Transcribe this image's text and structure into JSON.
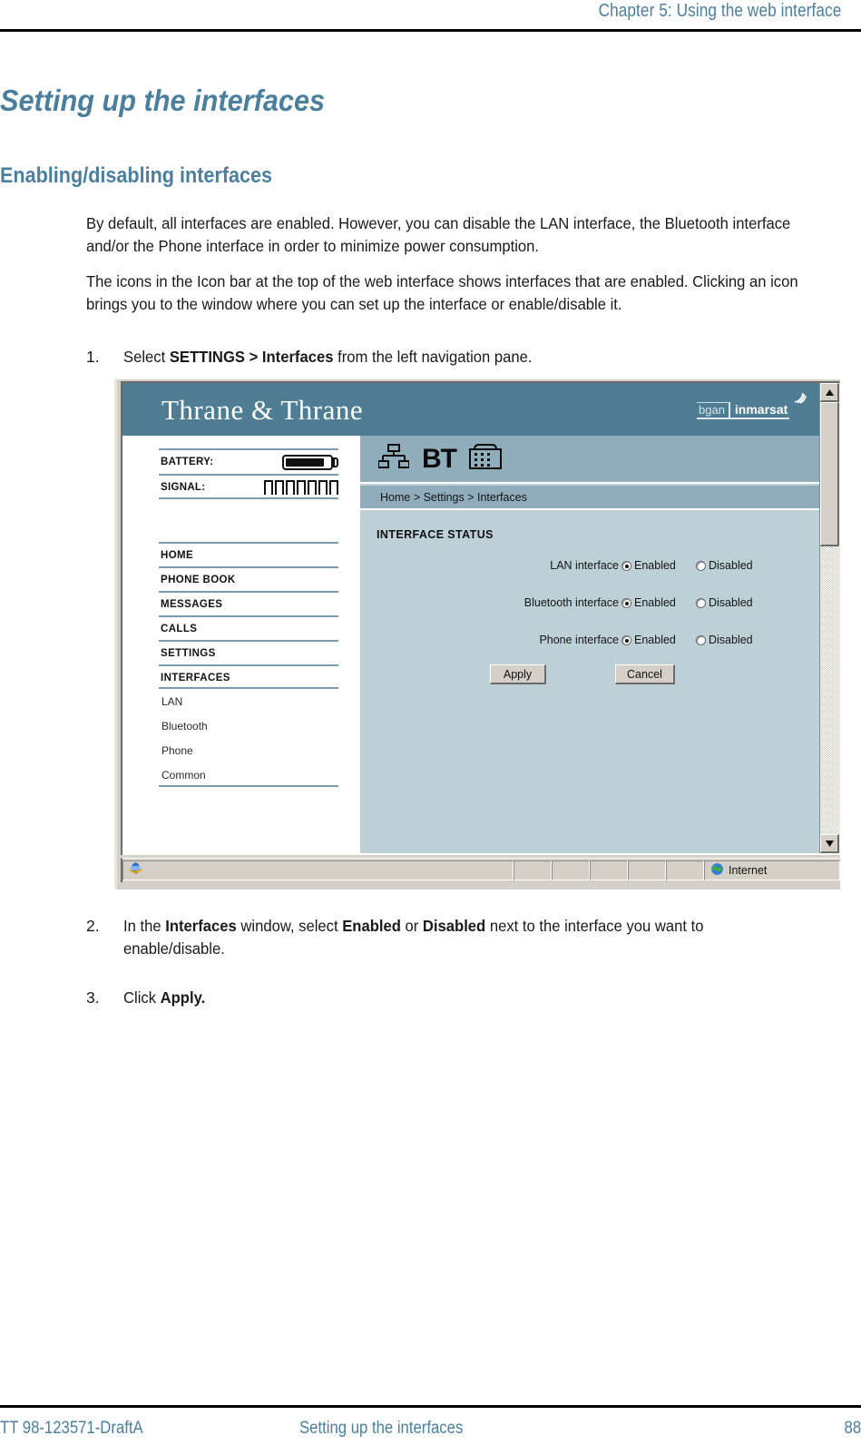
{
  "page": {
    "running_head": "Chapter 5: Using the web interface",
    "h1": "Setting up the interfaces",
    "h2": "Enabling/disabling interfaces",
    "paragraph_1": "By default, all interfaces are enabled. However, you can disable the LAN interface, the Bluetooth interface and/or the Phone interface in order to minimize power consumption.",
    "paragraph_2": "The icons in the Icon bar at the top of the web interface shows interfaces that are enabled. Clicking an icon brings you to the window where you can set up the interface or enable/disable it."
  },
  "steps": [
    {
      "number": "1.",
      "parts": [
        {
          "text": "Select ",
          "bold": false
        },
        {
          "text": "SETTINGS > Interfaces",
          "bold": true
        },
        {
          "text": " from the left navigation pane.",
          "bold": false
        }
      ]
    },
    {
      "number": "2.",
      "parts": [
        {
          "text": "In the ",
          "bold": false
        },
        {
          "text": "Interfaces",
          "bold": true
        },
        {
          "text": " window, select ",
          "bold": false
        },
        {
          "text": "Enabled",
          "bold": true
        },
        {
          "text": " or ",
          "bold": false
        },
        {
          "text": "Disabled",
          "bold": true
        },
        {
          "text": " next to the interface you want to enable/disable.",
          "bold": false
        }
      ]
    },
    {
      "number": "3.",
      "parts": [
        {
          "text": "Click ",
          "bold": false
        },
        {
          "text": "Apply.",
          "bold": true
        }
      ]
    }
  ],
  "screenshot": {
    "brand": {
      "logo_text": "Thrane & Thrane",
      "partner_primary": "bgan",
      "partner_secondary": "inmarsat",
      "satellite_icon": "satellite-signal-arcs-icon",
      "bar_color": "#4e7d94"
    },
    "status": {
      "battery_label": "BATTERY:",
      "battery_icon": "battery-icon",
      "battery_level_percent": 85,
      "signal_label": "SIGNAL:",
      "signal_icon": "signal-bars-icon",
      "signal_bar_count": 7,
      "signal_bars_filled": 0
    },
    "navigation": {
      "main_items": [
        {
          "label": "HOME",
          "name": "home"
        },
        {
          "label": "PHONE BOOK",
          "name": "phone-book"
        },
        {
          "label": "MESSAGES",
          "name": "messages"
        },
        {
          "label": "CALLS",
          "name": "calls"
        },
        {
          "label": "SETTINGS",
          "name": "settings"
        },
        {
          "label": "INTERFACES",
          "name": "interfaces"
        }
      ],
      "sub_items": [
        {
          "label": "LAN",
          "name": "lan"
        },
        {
          "label": "Bluetooth",
          "name": "bluetooth"
        },
        {
          "label": "Phone",
          "name": "phone"
        },
        {
          "label": "Common",
          "name": "common"
        }
      ]
    },
    "icon_bar": {
      "icons": [
        {
          "name": "lan-network-icon",
          "label": "LAN"
        },
        {
          "name": "bluetooth-bt-icon",
          "label": "BT"
        },
        {
          "name": "phone-keypad-icon",
          "label": "Phone"
        }
      ]
    },
    "breadcrumb": "Home > Settings > Interfaces",
    "form": {
      "section_title": "INTERFACE STATUS",
      "rows": [
        {
          "label": "LAN interface",
          "enabled_label": "Enabled",
          "disabled_label": "Disabled",
          "selected": "Enabled"
        },
        {
          "label": "Bluetooth interface",
          "enabled_label": "Enabled",
          "disabled_label": "Disabled",
          "selected": "Enabled"
        },
        {
          "label": "Phone interface",
          "enabled_label": "Enabled",
          "disabled_label": "Disabled",
          "selected": "Enabled"
        }
      ],
      "apply_label": "Apply",
      "cancel_label": "Cancel"
    },
    "scrollbar": {
      "up_arrow": "scroll-up-arrow-icon",
      "down_arrow": "scroll-down-arrow-icon"
    },
    "status_bar": {
      "browser_icon": "internet-explorer-icon",
      "zone_icon": "globe-icon",
      "zone_label": "Internet"
    }
  },
  "footer": {
    "left": "TT 98-123571-DraftA",
    "center": "Setting up the interfaces",
    "right": "88"
  },
  "colors": {
    "heading_blue": "#4a7f9e",
    "brand_teal": "#4e7d94",
    "icon_bar_blue": "#8fadba",
    "content_blue": "#bdd0d8",
    "nav_rule": "#7a9bb0",
    "chrome_gray": "#d4d0c8"
  }
}
